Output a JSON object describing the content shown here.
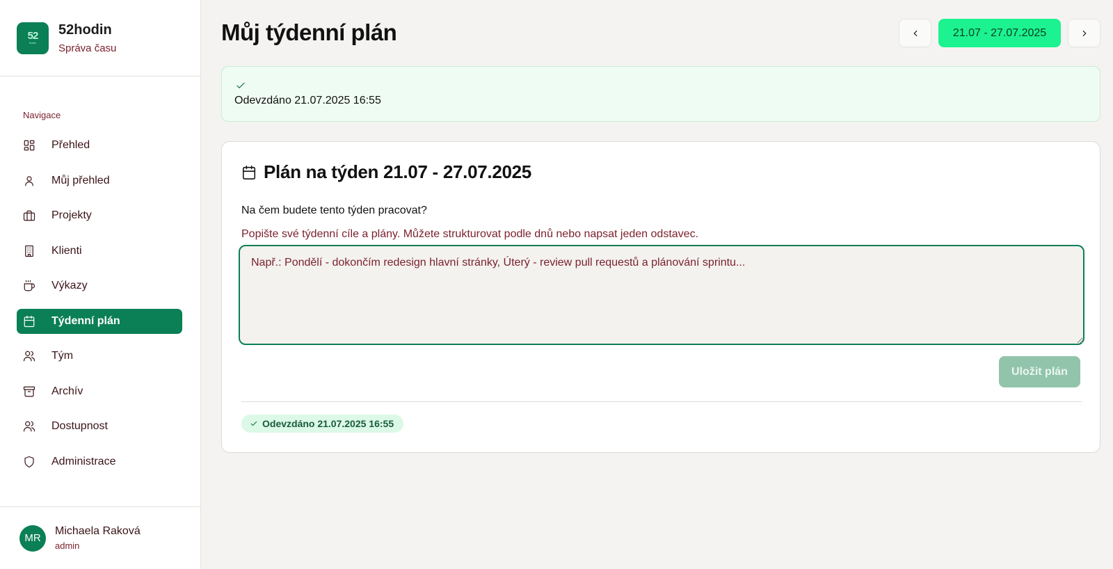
{
  "brand": {
    "logo_text": "52",
    "logo_sub": "hodin",
    "name": "52hodin",
    "subtitle": "Správa času"
  },
  "sidebar": {
    "section_label": "Navigace",
    "items": [
      {
        "label": "Přehled",
        "icon": "dashboard-icon",
        "active": false
      },
      {
        "label": "Můj přehled",
        "icon": "user-icon",
        "active": false
      },
      {
        "label": "Projekty",
        "icon": "briefcase-icon",
        "active": false
      },
      {
        "label": "Klienti",
        "icon": "building-icon",
        "active": false
      },
      {
        "label": "Výkazy",
        "icon": "coffee-icon",
        "active": false
      },
      {
        "label": "Týdenní plán",
        "icon": "calendar-icon",
        "active": true
      },
      {
        "label": "Tým",
        "icon": "users-icon",
        "active": false
      },
      {
        "label": "Archív",
        "icon": "archive-icon",
        "active": false
      },
      {
        "label": "Dostupnost",
        "icon": "users-icon",
        "active": false
      },
      {
        "label": "Administrace",
        "icon": "shield-icon",
        "active": false
      }
    ]
  },
  "user": {
    "initials": "MR",
    "name": "Michaela Raková",
    "role": "admin"
  },
  "header": {
    "title": "Můj týdenní plán",
    "week_range": "21.07 - 27.07.2025",
    "prev_icon": "chevron-left-icon",
    "next_icon": "chevron-right-icon"
  },
  "alert": {
    "icon": "check-icon",
    "text": "Odevzdáno 21.07.2025 16:55"
  },
  "card": {
    "title": "Plán na týden 21.07 - 27.07.2025",
    "question": "Na čem budete tento týden pracovat?",
    "hint": "Popište své týdenní cíle a plány. Můžete strukturovat podle dnů nebo napsat jeden odstavec.",
    "input_placeholder": "Např.: Pondělí - dokončím redesign hlavní stránky, Úterý - review pull requestů a plánování sprintu...",
    "input_value": "",
    "save_label": "Uložit plán",
    "badge_text": "Odevzdáno 21.07.2025 16:55"
  },
  "colors": {
    "accent": "#0b7f55",
    "week_button": "#1cf28f",
    "alert_bg": "#effcf3",
    "muted_text": "#7a1f2b"
  }
}
